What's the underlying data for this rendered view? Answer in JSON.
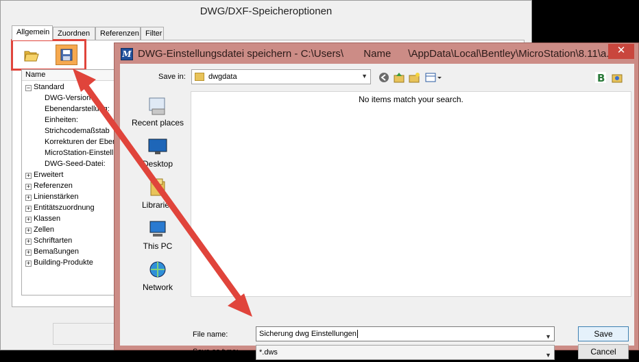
{
  "back_dialog": {
    "title": "DWG/DXF-Speicheroptionen",
    "tabs": [
      "Allgemein",
      "Zuordnen",
      "Referenzen",
      "Filter"
    ],
    "tree_header": "Name",
    "tree_items": [
      {
        "label": "Standard",
        "expander": "−"
      },
      {
        "label": "DWG-Version"
      },
      {
        "label": "Ebenendarstellung:"
      },
      {
        "label": "Einheiten:"
      },
      {
        "label": "Strichcodemaßstab"
      },
      {
        "label": "Korrekturen der Ebene"
      },
      {
        "label": "MicroStation-Einstellun"
      },
      {
        "label": "DWG-Seed-Datei:"
      },
      {
        "label": "Erweitert",
        "expander": "+"
      },
      {
        "label": "Referenzen",
        "expander": "+"
      },
      {
        "label": "Linienstärken",
        "expander": "+"
      },
      {
        "label": "Entitätszuordnung",
        "expander": "+"
      },
      {
        "label": "Klassen",
        "expander": "+"
      },
      {
        "label": "Zellen",
        "expander": "+"
      },
      {
        "label": "Schriftarten",
        "expander": "+"
      },
      {
        "label": "Bemaßungen",
        "expander": "+"
      },
      {
        "label": "Building-Produkte",
        "expander": "+"
      }
    ],
    "toolbar": {
      "open_icon": "folder-open-icon",
      "save_icon": "floppy-save-icon"
    }
  },
  "front_dialog": {
    "title": "DWG-Einstellungsdatei speichern - C:\\Users\\       Name      \\AppData\\Local\\Bentley\\MicroStation\\8.11\\a...",
    "close_label": "✕",
    "save_in_label": "Save in:",
    "save_in_value": "dwgdata",
    "empty_message": "No items match your search.",
    "places": [
      "Recent places",
      "Desktop",
      "Libraries",
      "This PC",
      "Network"
    ],
    "file_name_label": "File name:",
    "file_name_value": "Sicherung dwg Einstellungen",
    "save_as_type_label": "Save as type:",
    "save_as_type_value": "*.dws",
    "save_button": "Save",
    "cancel_button": "Cancel"
  },
  "colors": {
    "annotation": "#e0443b",
    "title_bar": "#cc8c86",
    "save_highlight": "#f6a94f"
  }
}
